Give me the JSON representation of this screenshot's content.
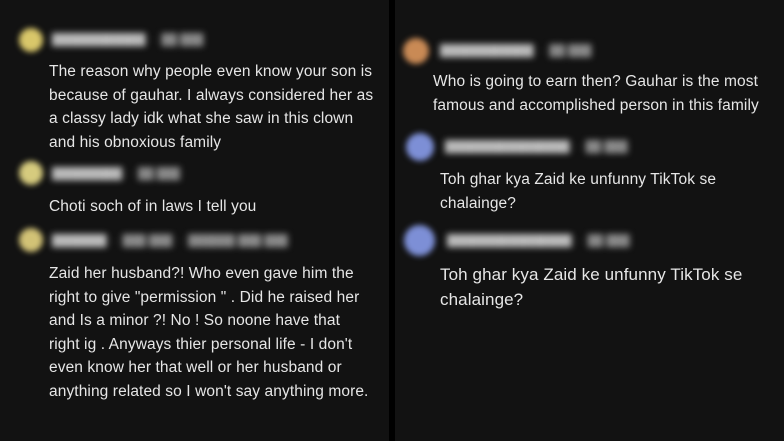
{
  "colors": {
    "background": "#121212",
    "divider": "#000000",
    "text": "#e6e6e6",
    "avatar_yellow": "#d9c76a",
    "avatar_orange": "#c98a55",
    "avatar_blue": "#7d8fd6"
  },
  "left_panel": {
    "comments": [
      {
        "avatar_icon": "user-avatar-icon",
        "text": "The reason why people even know your son is\nbecause of gauhar. I always considered her as\na classy lady idk what she saw in this clown\nand his obnoxious family"
      },
      {
        "avatar_icon": "user-avatar-icon",
        "text": "Choti soch of in laws I tell you"
      },
      {
        "avatar_icon": "user-avatar-icon",
        "text": "Zaid her husband?! Who even gave him the\nright to give \"permission \" . Did he raised her\nand Is a minor ?! No ! So noone have that\nright ig . Anyways thier personal life - I don't\neven know her that well or her husband or\nanything related so I won't say anything more."
      }
    ]
  },
  "right_panel": {
    "comments": [
      {
        "avatar_icon": "user-avatar-icon",
        "text": "Who is going to earn then? Gauhar is the most\nfamous and accomplished person in this family"
      },
      {
        "avatar_icon": "user-avatar-icon",
        "text": "Toh ghar kya Zaid ke unfunny TikTok se\nchalainge?"
      },
      {
        "avatar_icon": "user-avatar-icon",
        "text": "Toh ghar kya Zaid ke unfunny TikTok se\nchalainge?"
      }
    ]
  }
}
